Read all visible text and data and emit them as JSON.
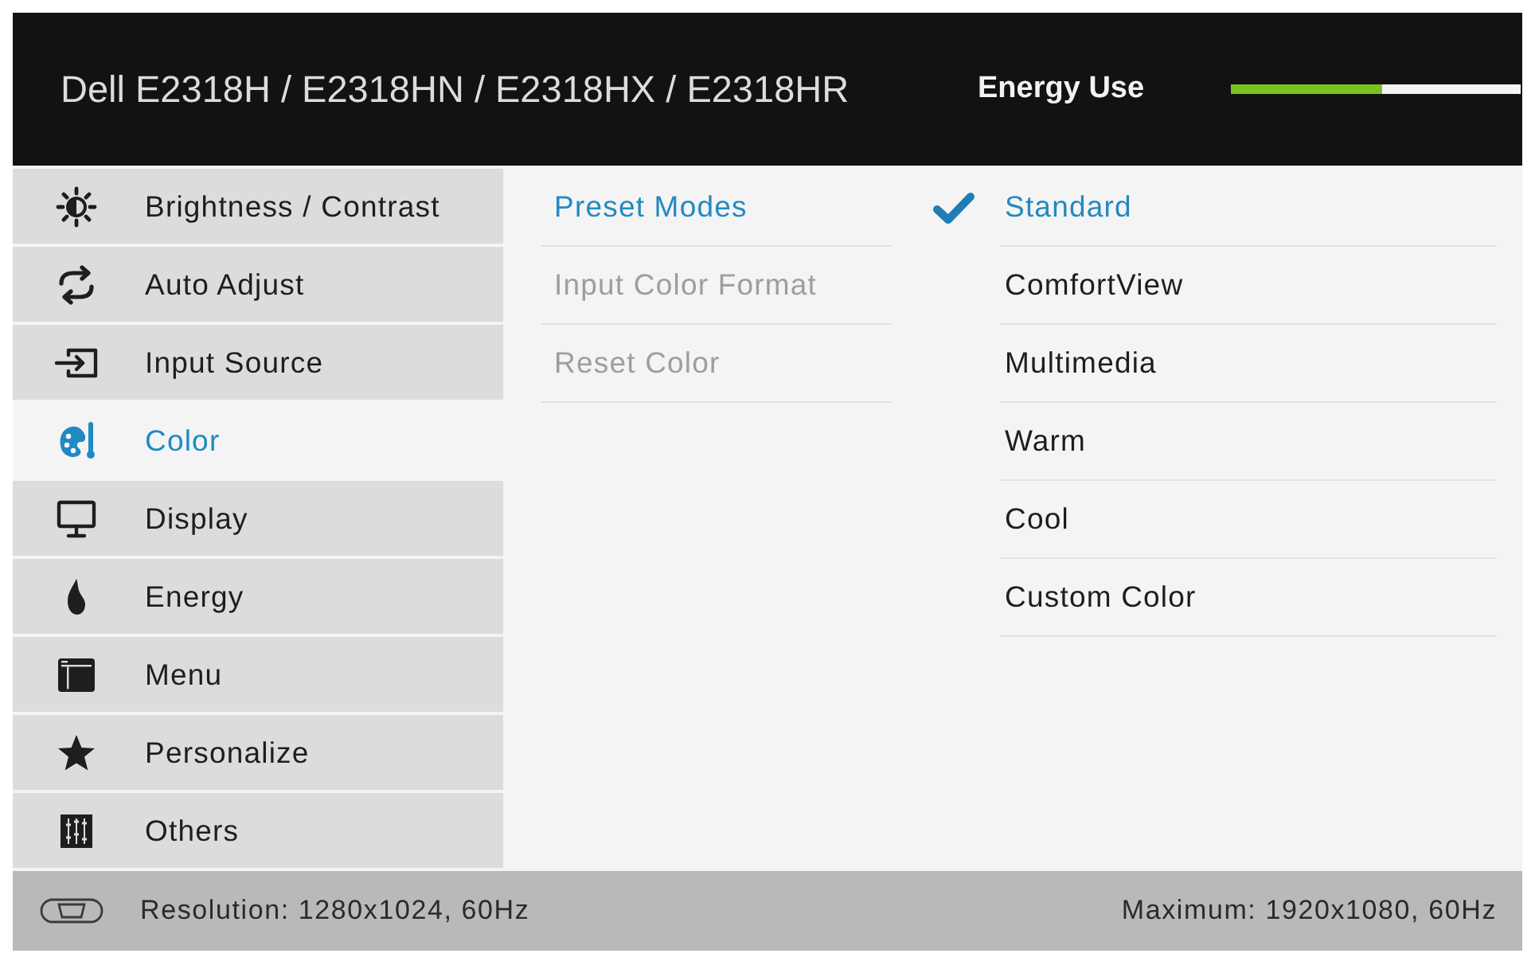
{
  "header": {
    "title": "Dell E2318H / E2318HN / E2318HX / E2318HR",
    "energy_label": "Energy Use",
    "energy_meter": {
      "level": 0.52
    }
  },
  "sidebar": {
    "items": [
      {
        "label": "Brightness / Contrast",
        "selected": false
      },
      {
        "label": "Auto Adjust",
        "selected": false
      },
      {
        "label": "Input Source",
        "selected": false
      },
      {
        "label": "Color",
        "selected": true
      },
      {
        "label": "Display",
        "selected": false
      },
      {
        "label": "Energy",
        "selected": false
      },
      {
        "label": "Menu",
        "selected": false
      },
      {
        "label": "Personalize",
        "selected": false
      },
      {
        "label": "Others",
        "selected": false
      }
    ]
  },
  "submenu": {
    "items": [
      {
        "label": "Preset Modes",
        "selected": true,
        "disabled": false
      },
      {
        "label": "Input Color Format",
        "selected": false,
        "disabled": true
      },
      {
        "label": "Reset Color",
        "selected": false,
        "disabled": true
      }
    ]
  },
  "options": {
    "items": [
      {
        "label": "Standard",
        "selected": true
      },
      {
        "label": "ComfortView",
        "selected": false
      },
      {
        "label": "Multimedia",
        "selected": false
      },
      {
        "label": "Warm",
        "selected": false
      },
      {
        "label": "Cool",
        "selected": false
      },
      {
        "label": "Custom Color",
        "selected": false
      }
    ]
  },
  "status_bar": {
    "left": "Resolution: 1280x1024, 60Hz",
    "right": "Maximum: 1920x1080, 60Hz"
  }
}
